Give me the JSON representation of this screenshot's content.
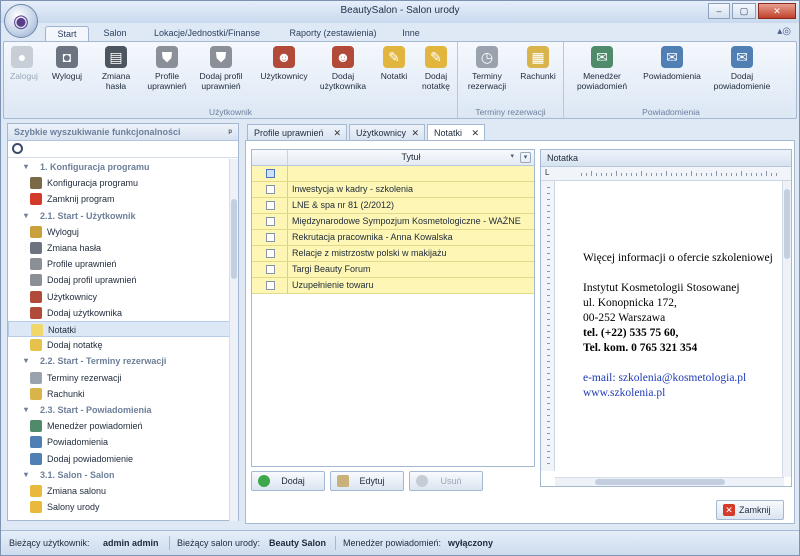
{
  "window": {
    "title": "BeautySalon - Salon urody",
    "minimize": "–",
    "maximize": "▢",
    "close": "✕"
  },
  "ribbon_tabs": [
    "Start",
    "Salon",
    "Lokacje/Jednostki/Finanse",
    "Raporty (zestawienia)",
    "Inne"
  ],
  "ribbon_groups": [
    {
      "label": "Użytkownik",
      "buttons": [
        {
          "label": "Zaloguj",
          "icon": "login-icon",
          "enabled": false
        },
        {
          "label": "Wyloguj",
          "icon": "padlock-icon",
          "enabled": true
        },
        {
          "label": "Zmiana hasła",
          "icon": "password-icon",
          "enabled": true
        },
        {
          "label": "Profile uprawnień",
          "icon": "shield-icon",
          "enabled": true
        },
        {
          "label": "Dodaj profil uprawnień",
          "icon": "shield-add-icon",
          "enabled": true
        },
        {
          "label": "Użytkownicy",
          "icon": "users-icon",
          "enabled": true
        },
        {
          "label": "Dodaj użytkownika",
          "icon": "user-add-icon",
          "enabled": true
        },
        {
          "label": "Notatki",
          "icon": "notes-icon",
          "enabled": true
        },
        {
          "label": "Dodaj notatkę",
          "icon": "note-add-icon",
          "enabled": true
        }
      ]
    },
    {
      "label": "Terminy rezerwacji",
      "buttons": [
        {
          "label": "Terminy rezerwacji",
          "icon": "clock-icon",
          "enabled": true
        },
        {
          "label": "Rachunki",
          "icon": "receipt-icon",
          "enabled": true
        }
      ]
    },
    {
      "label": "Powiadomienia",
      "buttons": [
        {
          "label": "Menedżer powiadomień",
          "icon": "mail-manager-icon",
          "enabled": true
        },
        {
          "label": "Powiadomienia",
          "icon": "mail-icon",
          "enabled": true
        },
        {
          "label": "Dodaj powiadomienie",
          "icon": "mail-add-icon",
          "enabled": true
        }
      ]
    }
  ],
  "left_panel": {
    "title": "Szybkie wyszukiwanie funkcjonalności",
    "pin": "ᵖ",
    "tree": [
      {
        "type": "group",
        "label": "1. Konfiguracja programu"
      },
      {
        "type": "item",
        "label": "Konfiguracja programu",
        "icon": "tools-icon",
        "color": "#7a6a48"
      },
      {
        "type": "item",
        "label": "Zamknij program",
        "icon": "close-circle-icon",
        "color": "#d43a28"
      },
      {
        "type": "group",
        "label": "2.1. Start - Użytkownik"
      },
      {
        "type": "item",
        "label": "Wyloguj",
        "icon": "padlock-icon",
        "color": "#c9a13a"
      },
      {
        "type": "item",
        "label": "Zmiana hasła",
        "icon": "password-icon",
        "color": "#6b7480"
      },
      {
        "type": "item",
        "label": "Profile uprawnień",
        "icon": "shield-icon",
        "color": "#8a8f98"
      },
      {
        "type": "item",
        "label": "Dodaj profil uprawnień",
        "icon": "shield-add-icon",
        "color": "#8a8f98"
      },
      {
        "type": "item",
        "label": "Użytkownicy",
        "icon": "users-icon",
        "color": "#b24a3a"
      },
      {
        "type": "item",
        "label": "Dodaj użytkownika",
        "icon": "user-add-icon",
        "color": "#b24a3a"
      },
      {
        "type": "item",
        "label": "Notatki",
        "icon": "notes-icon",
        "color": "#f1d66a",
        "selected": true
      },
      {
        "type": "item",
        "label": "Dodaj notatkę",
        "icon": "note-add-icon",
        "color": "#e6c24c"
      },
      {
        "type": "group",
        "label": "2.2. Start - Terminy rezerwacji"
      },
      {
        "type": "item",
        "label": "Terminy rezerwacji",
        "icon": "clock-icon",
        "color": "#9aa3ad"
      },
      {
        "type": "item",
        "label": "Rachunki",
        "icon": "receipt-icon",
        "color": "#d9b44a"
      },
      {
        "type": "group",
        "label": "2.3. Start - Powiadomienia"
      },
      {
        "type": "item",
        "label": "Menedżer powiadomień",
        "icon": "mail-manager-icon",
        "color": "#4f8a6b"
      },
      {
        "type": "item",
        "label": "Powiadomienia",
        "icon": "mail-icon",
        "color": "#4f7fb3"
      },
      {
        "type": "item",
        "label": "Dodaj powiadomienie",
        "icon": "mail-add-icon",
        "color": "#4f7fb3"
      },
      {
        "type": "group",
        "label": "3.1. Salon - Salon"
      },
      {
        "type": "item",
        "label": "Zmiana salonu",
        "icon": "star-icon",
        "color": "#e8b93a"
      },
      {
        "type": "item",
        "label": "Salony urody",
        "icon": "star-icon",
        "color": "#e8b93a"
      }
    ]
  },
  "doc_tabs": [
    {
      "label": "Profile uprawnień",
      "active": false
    },
    {
      "label": "Użytkownicy",
      "active": false
    },
    {
      "label": "Notatki",
      "active": true
    }
  ],
  "grid": {
    "column": "Tytuł",
    "rows": [
      "Inwestycja w kadry - szkolenia",
      "LNE & spa nr 81 (2/2012)",
      "Międzynarodowe Sympozjum Kosmetologiczne - WAŻNE",
      "Rekrutacja pracownika - Anna Kowalska",
      "Relacje z mistrzostw polski w makijażu",
      "Targi Beauty Forum",
      "Uzupełnienie towaru"
    ]
  },
  "grid_buttons": {
    "add": "Dodaj",
    "edit": "Edytuj",
    "delete": "Usuń"
  },
  "note": {
    "title": "Notatka",
    "ruler_mark": "L",
    "lines": [
      {
        "text": "Więcej informacji o ofercie szkoleniowej",
        "style": "normal"
      },
      {
        "text": "",
        "style": "normal"
      },
      {
        "text": "Instytut Kosmetologii Stosowanej",
        "style": "normal"
      },
      {
        "text": "ul. Konopnicka 172,",
        "style": "normal"
      },
      {
        "text": "00-252 Warszawa",
        "style": "normal"
      },
      {
        "text": "tel. (+22) 535 75 60,",
        "style": "phone"
      },
      {
        "text": "Tel. kom. 0 765 321 354",
        "style": "mobile"
      },
      {
        "text": "",
        "style": "normal"
      },
      {
        "text": "e-mail: szkolenia@kosmetologia.pl",
        "style": "email"
      },
      {
        "text": "www.szkolenia.pl",
        "style": "link"
      }
    ]
  },
  "close_button": "Zamknij",
  "status_bar": {
    "user_label": "Bieżący użytkownik:",
    "user_value": "admin admin",
    "salon_label": "Bieżący salon urody:",
    "salon_value": "Beauty Salon",
    "notif_label": "Menedżer powiadomień:",
    "notif_value": "wyłączony"
  }
}
